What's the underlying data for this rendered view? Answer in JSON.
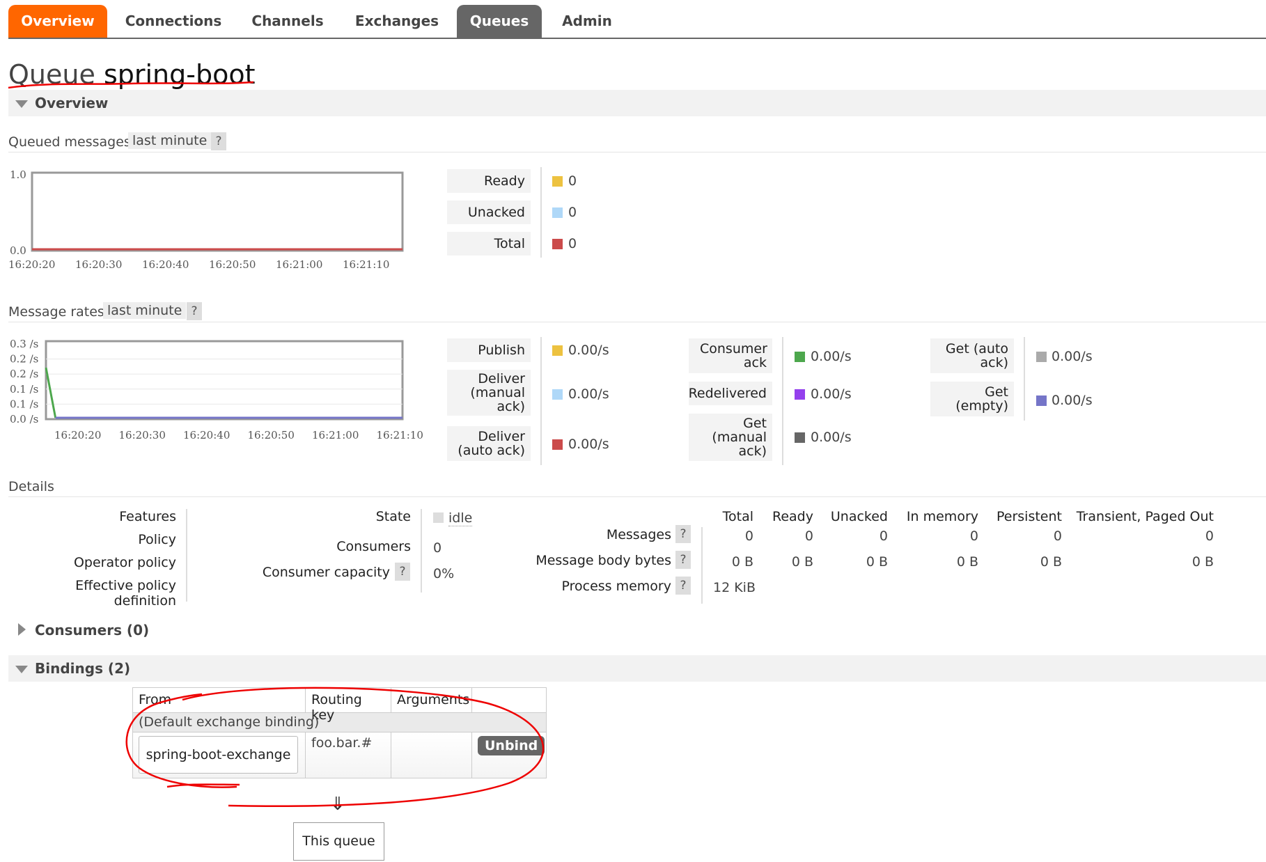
{
  "nav": {
    "tabs": [
      "Overview",
      "Connections",
      "Channels",
      "Exchanges",
      "Queues",
      "Admin"
    ]
  },
  "page": {
    "title_prefix": "Queue",
    "queue_name": "spring-boot"
  },
  "sections": {
    "overview": "Overview",
    "consumers": "Consumers (0)",
    "bindings": "Bindings (2)"
  },
  "queued_messages": {
    "heading": "Queued messages",
    "range": "last minute",
    "help": "?",
    "legend": [
      {
        "label": "Ready",
        "value": "0",
        "color": "#edc240"
      },
      {
        "label": "Unacked",
        "value": "0",
        "color": "#afd8f8"
      },
      {
        "label": "Total",
        "value": "0",
        "color": "#cb4b4b"
      }
    ]
  },
  "message_rates": {
    "heading": "Message rates",
    "range": "last minute",
    "help": "?",
    "col1": [
      {
        "label": "Publish",
        "value": "0.00/s",
        "color": "#edc240"
      },
      {
        "label": "Deliver (manual ack)",
        "value": "0.00/s",
        "color": "#afd8f8"
      },
      {
        "label": "Deliver (auto ack)",
        "value": "0.00/s",
        "color": "#cb4b4b"
      }
    ],
    "col2": [
      {
        "label": "Consumer ack",
        "value": "0.00/s",
        "color": "#4da74d"
      },
      {
        "label": "Redelivered",
        "value": "0.00/s",
        "color": "#9440ed"
      },
      {
        "label": "Get (manual ack)",
        "value": "0.00/s",
        "color": "#666666"
      }
    ],
    "col3": [
      {
        "label": "Get (auto ack)",
        "value": "0.00/s",
        "color": "#aaaaaa"
      },
      {
        "label": "Get (empty)",
        "value": "0.00/s",
        "color": "#7575c8"
      }
    ]
  },
  "chart_data": [
    {
      "type": "line",
      "title": "",
      "x": [
        "16:20:20",
        "16:20:30",
        "16:20:40",
        "16:20:50",
        "16:21:00",
        "16:21:10"
      ],
      "y_ticks": [
        "1.0",
        "0.0"
      ],
      "ylim": [
        0,
        1
      ],
      "series": [
        {
          "name": "Total",
          "color": "#cb4b4b",
          "values": [
            0,
            0,
            0,
            0,
            0,
            0
          ]
        }
      ],
      "grid": false
    },
    {
      "type": "line",
      "title": "",
      "x": [
        "16:20:20",
        "16:20:30",
        "16:20:40",
        "16:20:50",
        "16:21:00",
        "16:21:10"
      ],
      "y_ticks": [
        "0.3 /s",
        "0.2 /s",
        "0.2 /s",
        "0.1 /s",
        "0.1 /s",
        "0.0 /s"
      ],
      "ylim": [
        0,
        0.3
      ],
      "series": [
        {
          "name": "Consumer ack",
          "color": "#4da74d",
          "points": [
            [
              0,
              0.2
            ],
            [
              1.6,
              0
            ]
          ]
        },
        {
          "name": "Get (empty)",
          "color": "#7575c8",
          "points": [
            [
              1.6,
              0
            ],
            [
              60,
              0
            ]
          ]
        }
      ],
      "grid": true
    }
  ],
  "details": {
    "heading": "Details",
    "left_labels": [
      "Features",
      "Policy",
      "Operator policy",
      "Effective policy definition"
    ],
    "state_label": "State",
    "state_value": "idle",
    "consumers_label": "Consumers",
    "consumers_value": "0",
    "capacity_label": "Consumer capacity",
    "capacity_value": "0%",
    "help": "?",
    "columns": [
      "Total",
      "Ready",
      "Unacked",
      "In memory",
      "Persistent",
      "Transient, Paged Out"
    ],
    "rows": [
      {
        "label": "Messages",
        "values": [
          "0",
          "0",
          "0",
          "0",
          "0",
          "0"
        ]
      },
      {
        "label": "Message body bytes",
        "values": [
          "0 B",
          "0 B",
          "0 B",
          "0 B",
          "0 B",
          "0 B"
        ]
      },
      {
        "label": "Process memory",
        "values": [
          "12 KiB"
        ]
      }
    ]
  },
  "bindings": {
    "columns": [
      "From",
      "Routing key",
      "Arguments"
    ],
    "default_binding": "(Default exchange binding)",
    "row": {
      "exchange": "spring-boot-exchange",
      "routing_key": "foo.bar.#",
      "action": "Unbind"
    },
    "arrow": "⇓",
    "target": "This queue"
  }
}
